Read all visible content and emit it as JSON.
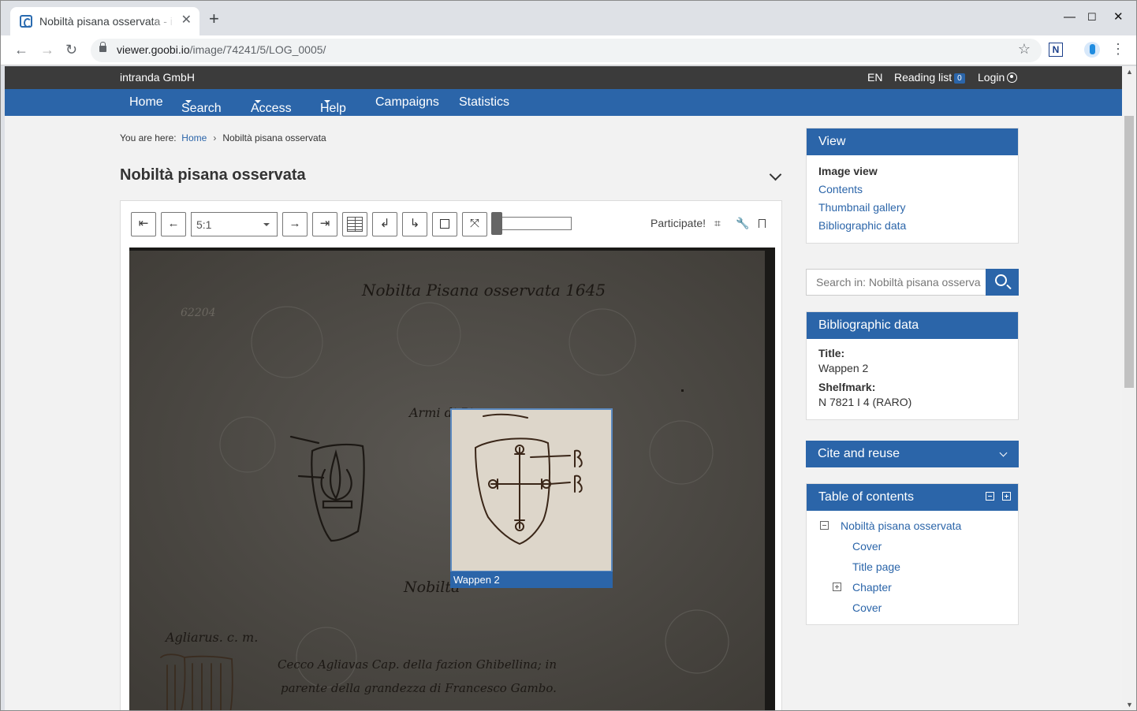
{
  "browser": {
    "tab_title": "Nobiltà pisana osservata - i",
    "url_host": "viewer.goobi.io",
    "url_path": "/image/74241/5/LOG_0005/"
  },
  "header": {
    "org": "intranda GmbH",
    "lang": "EN",
    "reading_list": "Reading list",
    "reading_count": "0",
    "login": "Login"
  },
  "nav": [
    "Home",
    "Search",
    "Access",
    "Help",
    "Campaigns",
    "Statistics"
  ],
  "breadcrumb": {
    "label": "You are here:",
    "home": "Home",
    "current": "Nobiltà pisana osservata"
  },
  "title": "Nobiltà pisana osservata",
  "viewer": {
    "zoom": "5:1",
    "participate": "Participate!",
    "region_label": "Wappen 2",
    "scan_texts": {
      "heading": "Nobilta Pisana osservata 1645",
      "number": "62204",
      "armi": "Armi di Pisa",
      "nobilta": "Nobilta",
      "agliarus": "Agliarus. c. m.",
      "line1": "Cecco Agliavas Cap. della fazion Ghibellina; in",
      "line2": "parente della grandezza di Francesco Gambo."
    }
  },
  "sidebar": {
    "view": {
      "title": "View",
      "current": "Image view",
      "links": [
        "Contents",
        "Thumbnail gallery",
        "Bibliographic data"
      ]
    },
    "search_placeholder": "Search in: Nobiltà pisana osserva",
    "bib": {
      "title": "Bibliographic data",
      "title_key": "Title:",
      "title_val": "Wappen 2",
      "shelf_key": "Shelfmark:",
      "shelf_val": "N 7821 I 4 (RARO)"
    },
    "cite": "Cite and reuse",
    "toc": {
      "title": "Table of contents",
      "root": "Nobiltà pisana osservata",
      "items": [
        "Cover",
        "Title page",
        "Chapter",
        "Cover"
      ]
    }
  }
}
